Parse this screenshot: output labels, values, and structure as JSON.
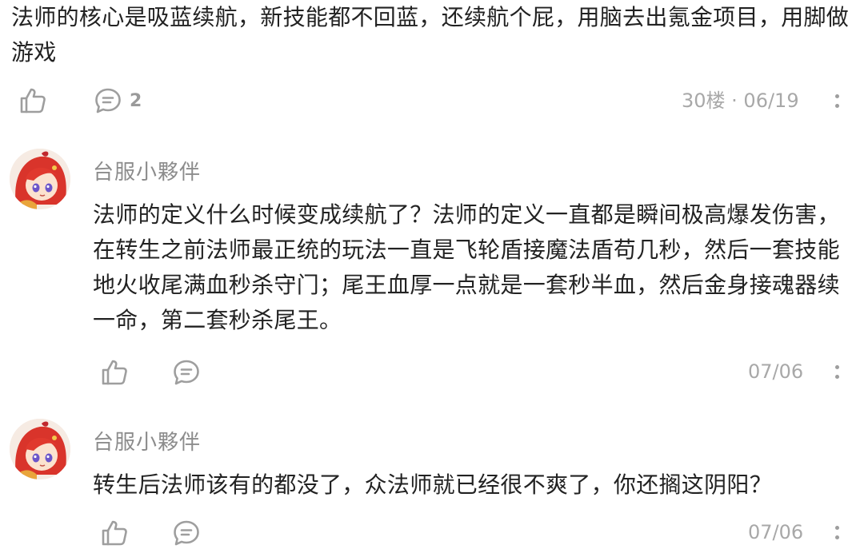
{
  "top_post": {
    "text": "法师的核心是吸蓝续航，新技能都不回蓝，还续航个屁，用脑去出氪金项目，用脚做游戏",
    "comment_count": "2",
    "floor_date": "30楼 · 06/19"
  },
  "replies": [
    {
      "username": "台服小夥伴",
      "text": "法师的定义什么时候变成续航了？法师的定义一直都是瞬间极高爆发伤害，在转生之前法师最正统的玩法一直是飞轮盾接魔法盾苟几秒，然后一套技能地火收尾满血秒杀守门；尾王血厚一点就是一套秒半血，然后金身接魂器续一命，第二套秒杀尾王。",
      "date": "07/06"
    },
    {
      "username": "台服小夥伴",
      "text": "转生后法师该有的都没了，众法师就已经很不爽了，你还搁这阴阳？",
      "date": "07/06"
    }
  ],
  "icons": {
    "like": "thumbs-up-icon",
    "comment": "comment-bubble-icon",
    "more": "more-vertical-icon"
  },
  "colors": {
    "icon_gray": "#9e9e9e",
    "meta_gray": "#a8a8a8",
    "username_gray": "#8c8c8c"
  }
}
